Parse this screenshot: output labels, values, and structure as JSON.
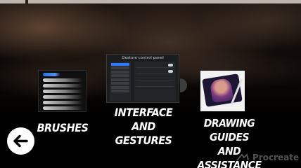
{
  "menu": {
    "items": [
      {
        "id": "brushes",
        "label": "BRUSHES"
      },
      {
        "id": "interface",
        "label": "INTERFACE AND\nGESTURES",
        "preview_title": "Gesture control panel"
      },
      {
        "id": "drawing",
        "label": "DRAWING\nGUIDES AND\nASSISTANCE"
      }
    ]
  },
  "back_button": {
    "icon": "back-arrow-icon"
  },
  "watermark": {
    "text": "Procreate"
  },
  "colors": {
    "accent": "#2f79ff",
    "label": "#ffffff",
    "background": "#000000"
  }
}
